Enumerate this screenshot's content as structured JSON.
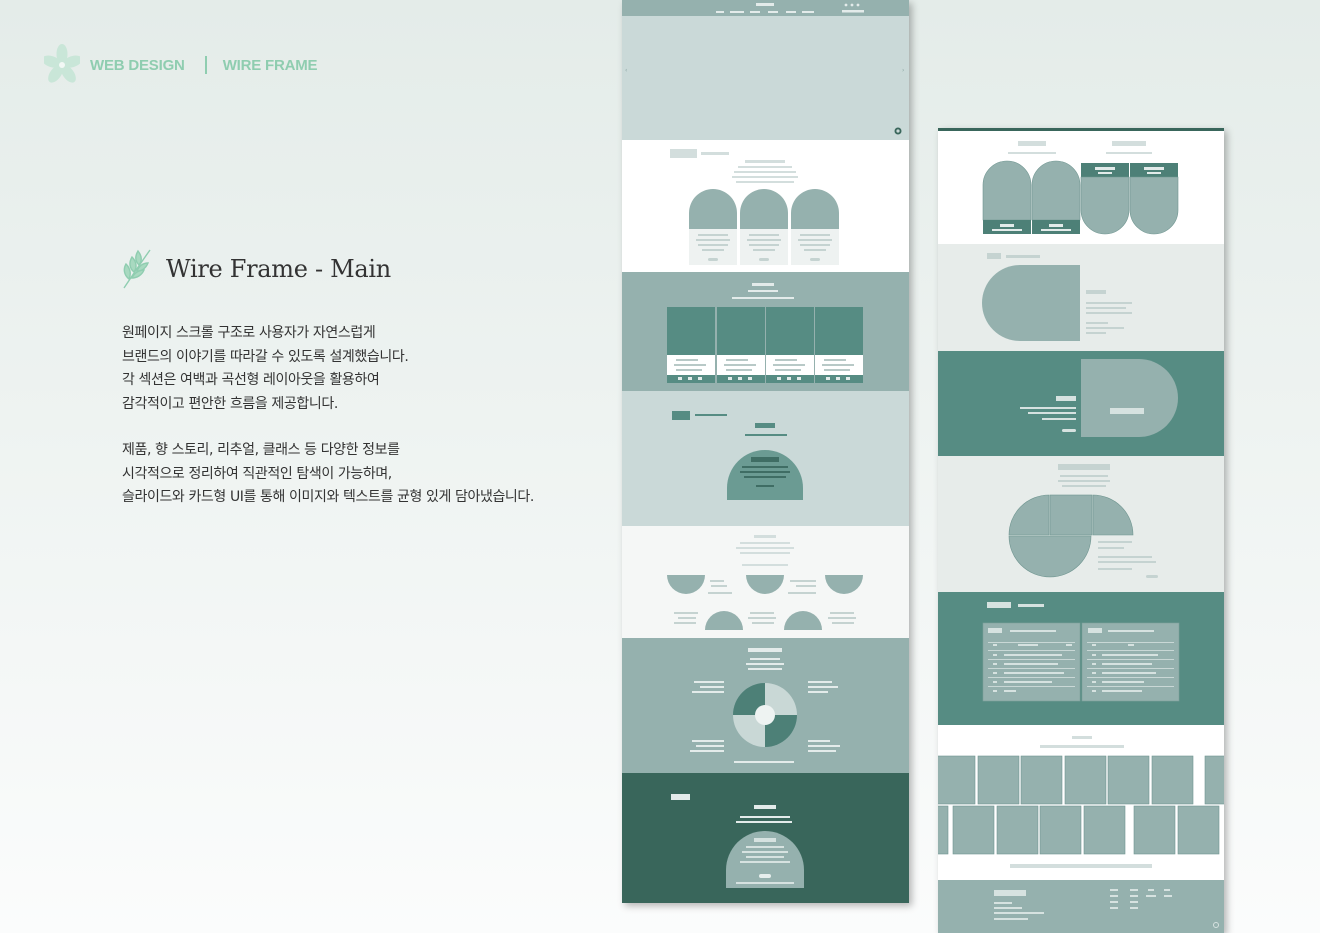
{
  "header": {
    "left_label": "WEB DESIGN",
    "right_label": "WIRE FRAME",
    "logo_icon": "flower-icon"
  },
  "section": {
    "title": "Wire Frame - Main",
    "title_icon": "leaf-sprig-icon",
    "paragraphs": [
      [
        "원페이지 스크롤 구조로 사용자가 자연스럽게",
        "브랜드의 이야기를 따라갈 수 있도록 설계했습니다.",
        "각 섹션은 여백과 곡선형 레이아웃을 활용하여",
        "감각적이고 편안한 흐름을 제공합니다."
      ],
      [
        "제품, 향 스토리, 리추얼, 클래스 등 다양한 정보를",
        "시각적으로 정리하여 직관적인 탐색이 가능하며,",
        "슬라이드와 카드형 UI를 통해 이미지와 텍스트를 균형 있게 담아냈습니다."
      ]
    ]
  },
  "colors": {
    "accent": "#8fcdb0",
    "dark_green": "#39665b",
    "teal": "#568c83",
    "sage": "#95b1ae",
    "light_sage": "#cad9d8",
    "pale": "#e7ecea",
    "placeholder": "#c5d3d1"
  },
  "wireframes": [
    {
      "name": "main-page-left",
      "sections": [
        "header",
        "hero-slider",
        "products-arches",
        "carousel-cards",
        "feature-dome",
        "story-half-circles",
        "ritual-wheel",
        "class-dome"
      ]
    },
    {
      "name": "main-page-right",
      "sections": [
        "arch-cards",
        "side-blob",
        "teal-feature",
        "pie-split",
        "info-board",
        "gallery-grid",
        "footer"
      ]
    }
  ]
}
